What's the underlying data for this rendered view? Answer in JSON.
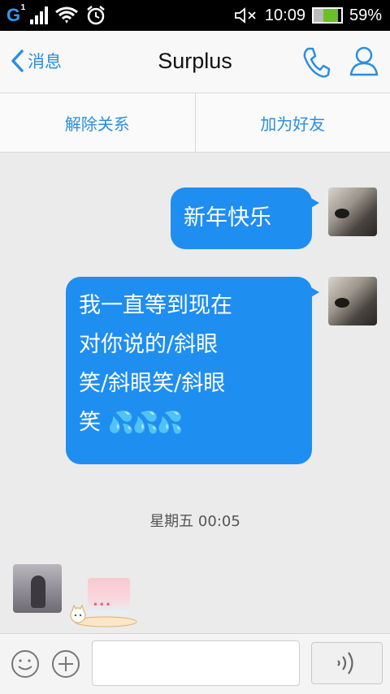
{
  "status_bar": {
    "network": "G",
    "sim": "1",
    "time": "10:09",
    "battery_percent_text": "59%",
    "battery_level": 0.59
  },
  "nav": {
    "back_label": "消息",
    "title": "Surplus"
  },
  "actions": {
    "remove_relation": "解除关系",
    "add_friend": "加为好友"
  },
  "messages": [
    {
      "from": "me",
      "text": "新年快乐"
    },
    {
      "from": "me",
      "lines": [
        "我一直等到现在",
        "对你说的/斜眼",
        "笑/斜眼笑/斜眼",
        "笑"
      ]
    }
  ],
  "timestamp": "星期五 00:05",
  "typing_indicator": "...",
  "icons": {
    "back": "chevron-left-icon",
    "call": "phone-icon",
    "profile": "person-icon",
    "emoji": "smiley-icon",
    "more": "plus-icon",
    "voice": "voice-wave-icon",
    "sweat": "sweat-drops-icon"
  },
  "colors": {
    "accent": "#2a8fe0",
    "bubble": "#1f8ef1",
    "battery": "#6bbf2a"
  }
}
